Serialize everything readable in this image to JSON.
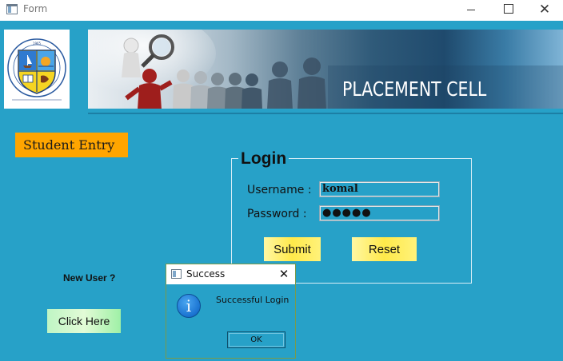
{
  "window": {
    "title": "Form",
    "close_glyph": "✕",
    "icon": "app-window-icon"
  },
  "header": {
    "banner_title": "PLACEMENT CELL",
    "logo": {
      "year": "1965",
      "top_text": "EMINENCE DEDICATION ALWAYS FOR EXCELLENCE",
      "bottom_text": "FOR THE STREAM OF LIGHT"
    }
  },
  "left": {
    "student_entry_label": "Student Entry",
    "new_user_label": "New User ?",
    "click_here_label": "Click Here"
  },
  "login": {
    "legend": "Login",
    "username_label": "Username :",
    "password_label": "Password :",
    "username_value": "komal",
    "password_value": "●●●●●",
    "submit_label": "Submit",
    "reset_label": "Reset"
  },
  "dialog": {
    "title": "Success",
    "close_glyph": "✕",
    "message": "Successful Login",
    "icon_glyph": "i",
    "ok_label": "OK"
  },
  "colors": {
    "background": "#27a1c8",
    "student_entry": "#ffa500",
    "yellow_button": "#ffe94a",
    "green_button": "#b7f3bd"
  }
}
